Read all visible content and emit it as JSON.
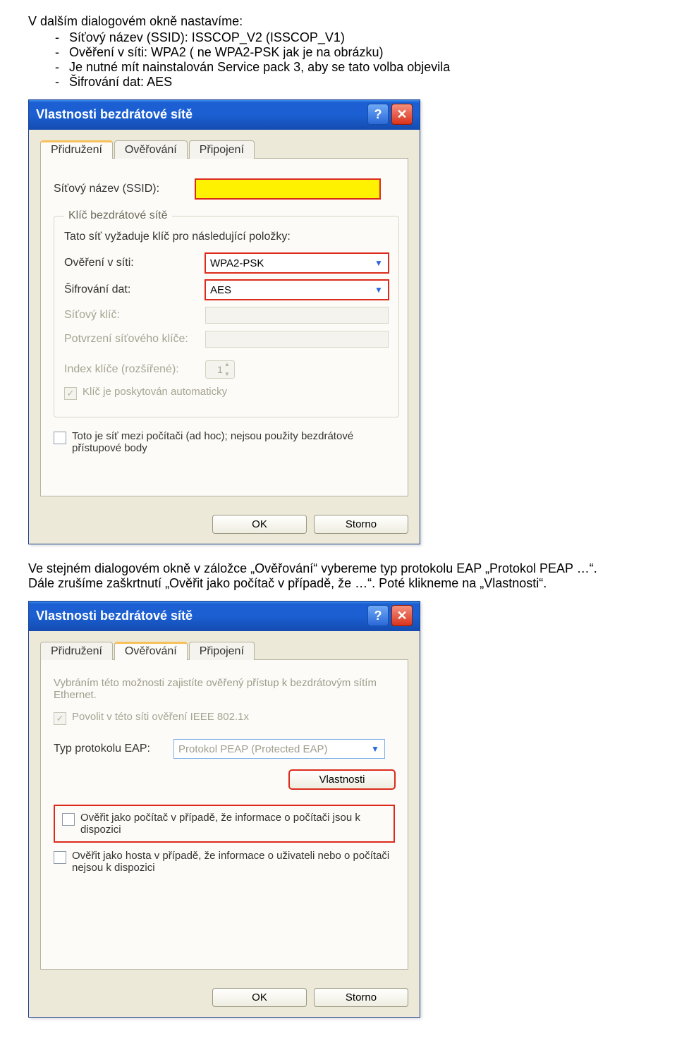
{
  "intro": "V dalším dialogovém okně nastavíme:",
  "bullets": [
    "Síťový název (SSID): ISSCOP_V2 (ISSCOP_V1)",
    "Ověření v síti: WPA2 ( ne WPA2-PSK jak je na obrázku)",
    "Je nutné mít nainstalován Service pack 3, aby se tato volba objevila",
    "Šifrování dat: AES"
  ],
  "dlg1": {
    "title": "Vlastnosti bezdrátové sítě",
    "tabs": {
      "assoc": "Přidružení",
      "auth": "Ověřování",
      "conn": "Připojení"
    },
    "ssid_label": "Síťový název (SSID):",
    "group_legend": "Klíč bezdrátové sítě",
    "group_text": "Tato síť vyžaduje klíč pro následující položky:",
    "auth_label": "Ověření v síti:",
    "auth_value": "WPA2-PSK",
    "enc_label": "Šifrování dat:",
    "enc_value": "AES",
    "key_label": "Síťový klíč:",
    "key2_label": "Potvrzení síťového klíče:",
    "index_label": "Index klíče (rozšířené):",
    "index_value": "1",
    "autokey": "Klíč je poskytován automaticky",
    "adhoc": "Toto je síť mezi počítači (ad hoc); nejsou použity bezdrátové přístupové body",
    "ok": "OK",
    "cancel": "Storno"
  },
  "para2_a": "Ve stejném dialogovém okně v záložce „Ověřování“ vybereme typ protokolu EAP „Protokol PEAP …“.",
  "para2_b": "Dále zrušíme zaškrtnutí „Ověřit jako počítač v případě, že …“. Poté klikneme na „Vlastnosti“.",
  "dlg2": {
    "title": "Vlastnosti bezdrátové sítě",
    "tabs": {
      "assoc": "Přidružení",
      "auth": "Ověřování",
      "conn": "Připojení"
    },
    "note": "Vybráním této možnosti zajistíte ověřený přístup k bezdrátovým sítím Ethernet.",
    "enable8021x": "Povolit v této síti ověření IEEE 802.1x",
    "eap_label": "Typ protokolu EAP:",
    "eap_value": "Protokol PEAP (Protected EAP)",
    "props_btn": "Vlastnosti",
    "check_computer": "Ověřit jako počítač v případě, že informace o počítači jsou k dispozici",
    "check_guest": "Ověřit jako hosta v případě, že informace o uživateli nebo o počítači nejsou k dispozici",
    "ok": "OK",
    "cancel": "Storno"
  }
}
